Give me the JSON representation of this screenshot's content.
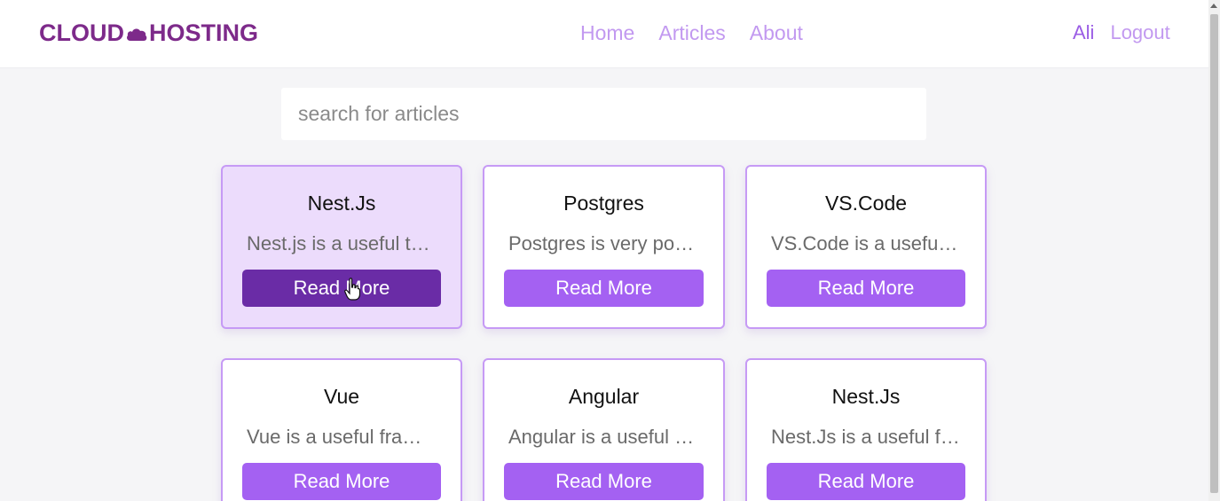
{
  "brand": {
    "part1": "CLOUD",
    "part2": "HOSTING",
    "icon": "cloud-icon",
    "color": "#7d2a8a"
  },
  "nav": {
    "items": [
      {
        "label": "Home"
      },
      {
        "label": "Articles"
      },
      {
        "label": "About"
      }
    ]
  },
  "user": {
    "name": "Ali",
    "logout_label": "Logout"
  },
  "search": {
    "placeholder": "search for articles",
    "value": ""
  },
  "articles": [
    {
      "title": "Nest.Js",
      "description": "Nest.js is a useful tool for backend",
      "button_label": "Read More",
      "state": "hovered"
    },
    {
      "title": "Postgres",
      "description": "Postgres is very powerful database",
      "button_label": "Read More"
    },
    {
      "title": "VS.Code",
      "description": "VS.Code is a useful editor",
      "button_label": "Read More"
    },
    {
      "title": "Vue",
      "description": "Vue is a useful framework",
      "button_label": "Read More"
    },
    {
      "title": "Angular",
      "description": "Angular is a useful framework",
      "button_label": "Read More"
    },
    {
      "title": "Nest.Js",
      "description": "Nest.Js is a useful framework",
      "button_label": "Read More"
    }
  ],
  "colors": {
    "accent": "#a461f2",
    "accent_dark": "#6a2ca6",
    "nav_link": "#c299f0",
    "card_border": "#c69af5",
    "card_active_bg": "#ecdcfc"
  }
}
